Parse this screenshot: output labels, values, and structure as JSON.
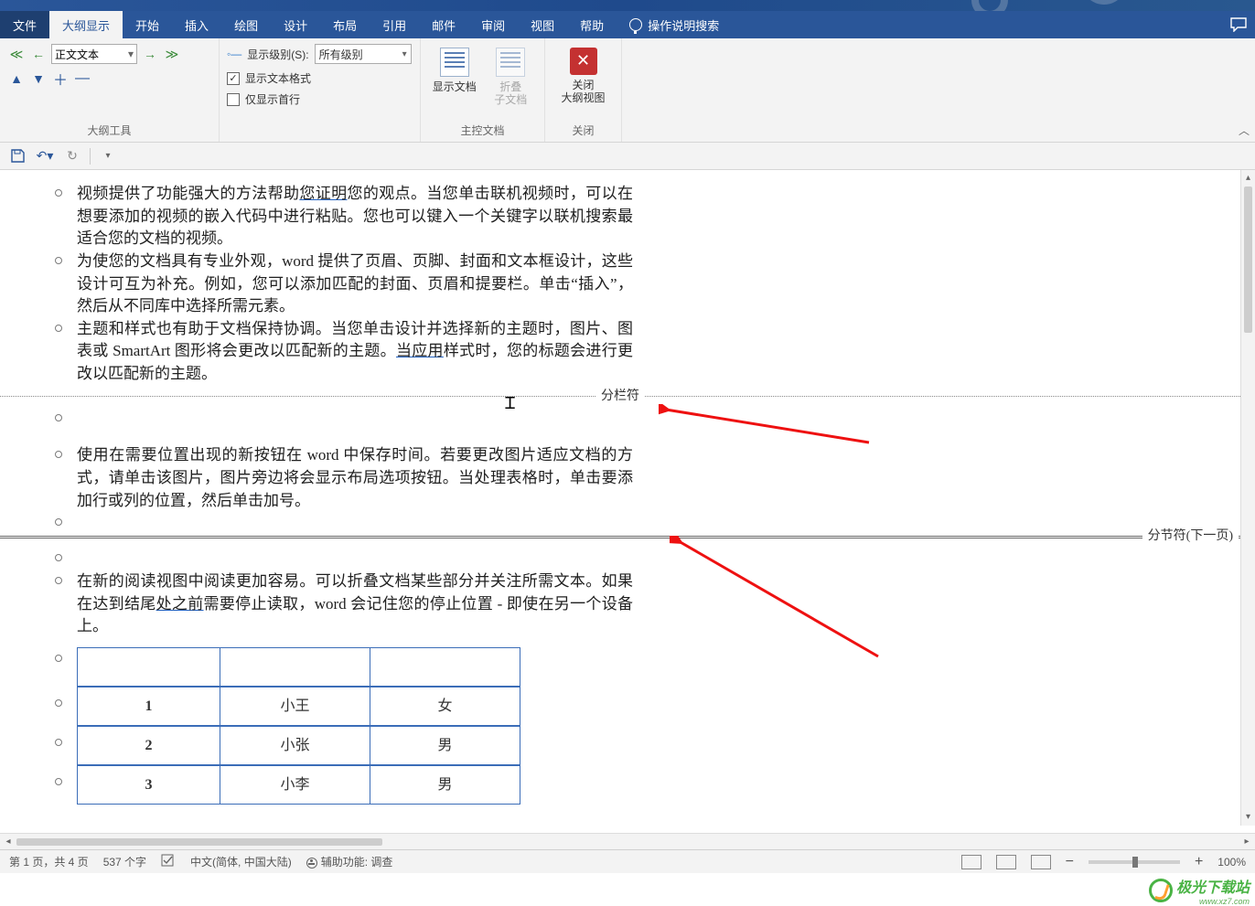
{
  "tabs": {
    "file": "文件",
    "outline": "大纲显示",
    "home": "开始",
    "insert": "插入",
    "draw": "绘图",
    "design": "设计",
    "layout": "布局",
    "ref": "引用",
    "mail": "邮件",
    "review": "审阅",
    "view": "视图",
    "help": "帮助",
    "tell": "操作说明搜索"
  },
  "ribbon": {
    "outline_level": "正文文本",
    "show_level_label": "显示级别(S):",
    "show_level_value": "所有级别",
    "show_format": "显示文本格式",
    "first_line": "仅显示首行",
    "group_outline": "大纲工具",
    "show_doc": "显示文档",
    "collapse_sub": "折叠\n子文档",
    "group_master": "主控文档",
    "close_view": "关闭\n大纲视图",
    "group_close": "关闭"
  },
  "doc": {
    "p1": "视频提供了功能强大的方法帮助<u>您证明</u>您的观点。当您单击联机视频时，可以在想要添加的视频的嵌入代码中进行粘贴。您也可以键入一个关键字以联机搜索最适合您的文档的视频。",
    "p2": "为使您的文档具有专业外观，word 提供了页眉、页脚、封面和文本框设计，这些设计可互为补充。例如，您可以添加匹配的封面、页眉和提要栏。单击“插入”，然后从不同库中选择所需元素。",
    "p3": "主题和样式也有助于文档保持协调。当您单击设计并选择新的主题时，图片、图表或 SmartArt 图形将会更改以匹配新的主题。<u>当应用</u>样式时，您的标题会进行更改以匹配新的主题。",
    "break1": "分栏符",
    "p4": "使用在需要位置出现的新按钮在 word 中保存时间。若要更改图片适应文档的方式，请单击该图片，图片旁边将会显示布局选项按钮。当处理表格时，单击要添加行或列的位置，然后单击加号。",
    "break2": "分节符(下一页)",
    "p5": "在新的阅读视图中阅读更加容易。可以折叠文档某些部分并关注所需文本。如果在达到结尾<u>处之前</u>需要停止读取，word 会记住您的停止位置 - 即使在另一个设备上。",
    "table": {
      "rows": [
        [
          "1",
          "小王",
          "女"
        ],
        [
          "2",
          "小张",
          "男"
        ],
        [
          "3",
          "小李",
          "男"
        ]
      ]
    }
  },
  "status": {
    "page": "第 1 页，共 4 页",
    "words": "537 个字",
    "lang": "中文(简体, 中国大陆)",
    "access": "辅助功能: 调查",
    "zoom": "100%"
  },
  "watermark": {
    "name": "极光下载站",
    "url": "www.xz7.com"
  }
}
